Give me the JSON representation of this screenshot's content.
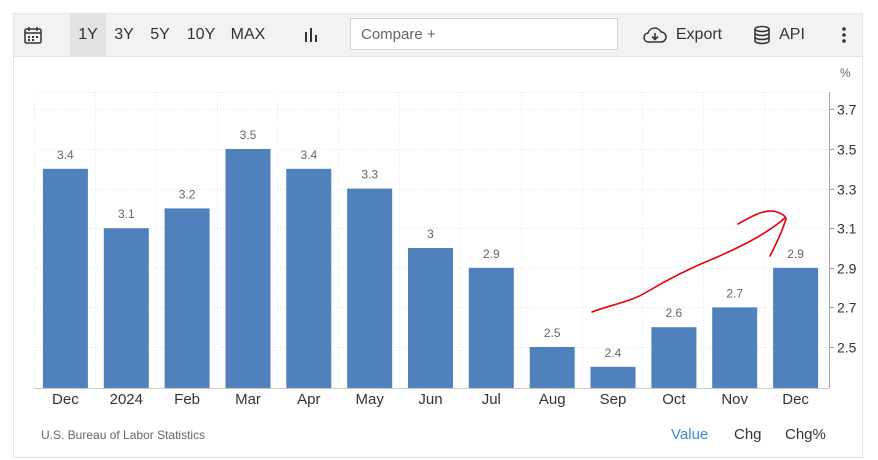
{
  "toolbar": {
    "ranges": [
      "1Y",
      "3Y",
      "5Y",
      "10Y",
      "MAX"
    ],
    "active_range": "1Y",
    "compare_placeholder": "Compare +",
    "export_label": "Export",
    "api_label": "API"
  },
  "unit": "%",
  "footer": {
    "source": "U.S. Bureau of Labor Statistics",
    "modes": [
      "Value",
      "Chg",
      "Chg%"
    ],
    "active_mode": "Value"
  },
  "colors": {
    "bar": "#4f81bd",
    "annotation": "#e8000b",
    "active_mode": "#3a8fd6"
  },
  "chart_data": {
    "type": "bar",
    "title": "",
    "xlabel": "",
    "ylabel": "",
    "categories": [
      "Dec",
      "2024",
      "Feb",
      "Mar",
      "Apr",
      "May",
      "Jun",
      "Jul",
      "Aug",
      "Sep",
      "Oct",
      "Nov",
      "Dec"
    ],
    "values": [
      3.4,
      3.1,
      3.2,
      3.5,
      3.4,
      3.3,
      3,
      2.9,
      2.5,
      2.4,
      2.6,
      2.7,
      2.9
    ],
    "data_labels": [
      "3.4",
      "3.1",
      "3.2",
      "3.5",
      "3.4",
      "3.3",
      "3",
      "2.9",
      "2.5",
      "2.4",
      "2.6",
      "2.7",
      "2.9"
    ],
    "y_ticks": [
      "2.5",
      "2.7",
      "2.9",
      "3.1",
      "3.3",
      "3.5",
      "3.7"
    ],
    "ylim": [
      2.3,
      3.8
    ],
    "grid": true,
    "y_axis_side": "right",
    "annotation": "hand-drawn red upward arrow from Sep to Dec"
  }
}
